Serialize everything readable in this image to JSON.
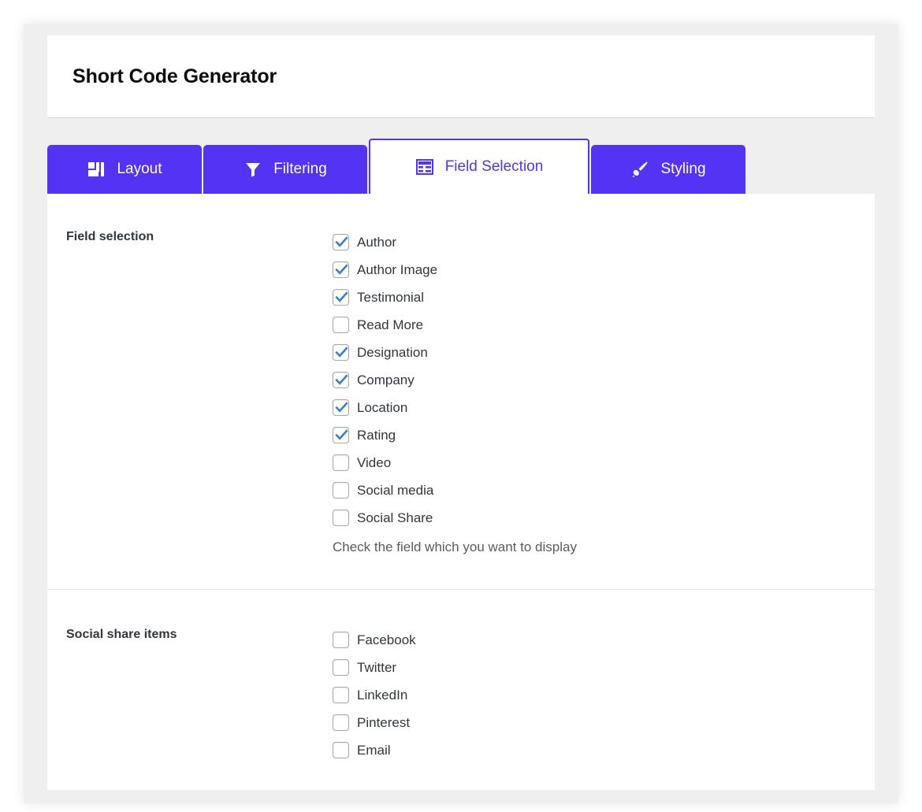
{
  "header": {
    "title": "Short Code Generator"
  },
  "tabs": [
    {
      "label": "Layout",
      "icon": "layout-grid-icon",
      "active": false
    },
    {
      "label": "Filtering",
      "icon": "funnel-icon",
      "active": false
    },
    {
      "label": "Field Selection",
      "icon": "table-icon",
      "active": true
    },
    {
      "label": "Styling",
      "icon": "paintbrush-icon",
      "active": false
    }
  ],
  "field_selection": {
    "label": "Field selection",
    "help_text": "Check the field which you want to display",
    "items": [
      {
        "label": "Author",
        "checked": true
      },
      {
        "label": "Author Image",
        "checked": true
      },
      {
        "label": "Testimonial",
        "checked": true
      },
      {
        "label": "Read More",
        "checked": false
      },
      {
        "label": "Designation",
        "checked": true
      },
      {
        "label": "Company",
        "checked": true
      },
      {
        "label": "Location",
        "checked": true
      },
      {
        "label": "Rating",
        "checked": true
      },
      {
        "label": "Video",
        "checked": false
      },
      {
        "label": "Social media",
        "checked": false
      },
      {
        "label": "Social Share",
        "checked": false
      }
    ]
  },
  "social_share": {
    "label": "Social share items",
    "items": [
      {
        "label": "Facebook",
        "checked": false
      },
      {
        "label": "Twitter",
        "checked": false
      },
      {
        "label": "LinkedIn",
        "checked": false
      },
      {
        "label": "Pinterest",
        "checked": false
      },
      {
        "label": "Email",
        "checked": false
      }
    ]
  },
  "colors": {
    "tab_purple": "#5433f5",
    "checkbox_check": "#3e7fc4",
    "text_dark": "#32373c",
    "page_gray": "#efefef"
  }
}
